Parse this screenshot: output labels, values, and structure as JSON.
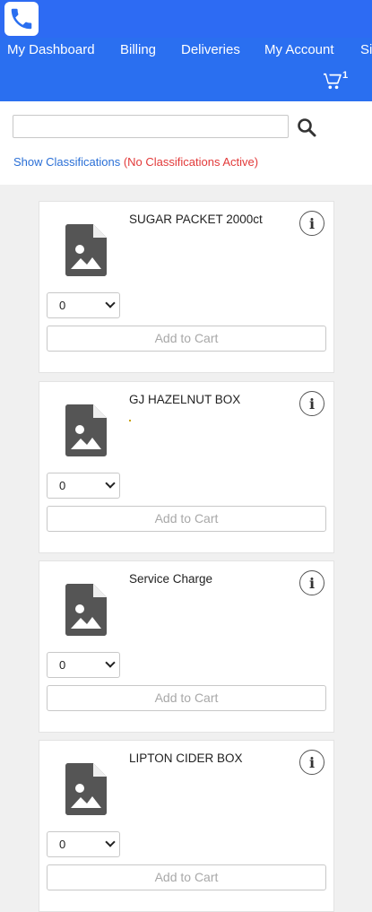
{
  "nav": {
    "items": [
      {
        "label": "My Dashboard"
      },
      {
        "label": "Billing"
      },
      {
        "label": "Deliveries"
      },
      {
        "label": "My Account"
      },
      {
        "label": "Si"
      }
    ],
    "cart_count": "1"
  },
  "search": {
    "value": "",
    "placeholder": ""
  },
  "classifications": {
    "link": "Show Classifications",
    "status": "(No Classifications Active)"
  },
  "products": [
    {
      "name": "SUGAR PACKET 2000ct",
      "qty": "0",
      "add_label": "Add to Cart"
    },
    {
      "name": "GJ HAZELNUT BOX",
      "qty": "0",
      "add_label": "Add to Cart"
    },
    {
      "name": "Service Charge",
      "qty": "0",
      "add_label": "Add to Cart"
    },
    {
      "name": "LIPTON CIDER BOX",
      "qty": "0",
      "add_label": "Add to Cart"
    }
  ],
  "colors": {
    "header": "#2a6ff0",
    "link": "#2a6fd6",
    "warning": "#e23a3a"
  }
}
